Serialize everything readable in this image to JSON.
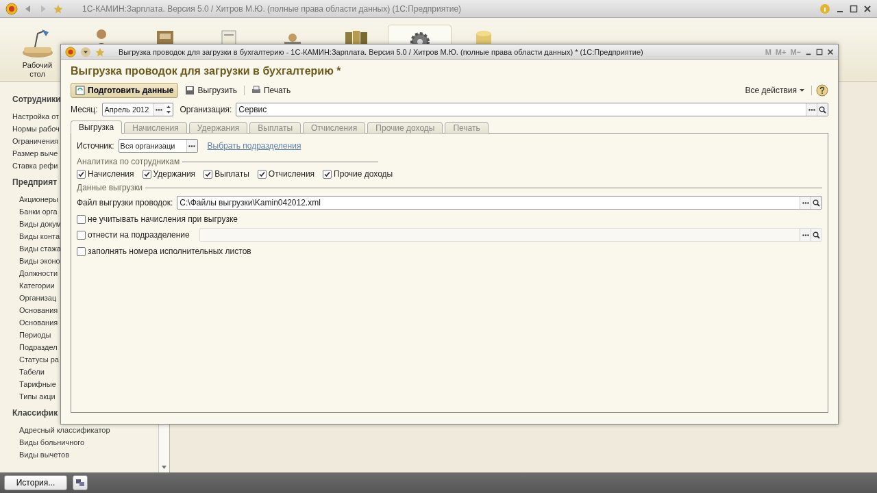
{
  "window": {
    "title": "1С-КАМИН:Зарплата. Версия 5.0 / Хитров М.Ю. (полные права области данных)  (1С:Предприятие)"
  },
  "section_bar": {
    "items": [
      {
        "kind": "desk",
        "label": "Рабочий стол",
        "selected": false
      },
      {
        "kind": "person",
        "selected": false
      },
      {
        "kind": "cabinet",
        "selected": false
      },
      {
        "kind": "document",
        "selected": false
      },
      {
        "kind": "people",
        "selected": false
      },
      {
        "kind": "books",
        "selected": false
      },
      {
        "kind": "gear",
        "selected": true
      },
      {
        "kind": "database",
        "selected": false
      }
    ]
  },
  "sidebar": {
    "groups": [
      {
        "title": "Сотрудники",
        "items": [
          "Настройка от",
          "Нормы рабоч",
          "Ограничения",
          "Размер выче",
          "Ставка рефи"
        ]
      },
      {
        "title": "Предприят",
        "items": [
          "Акционеры",
          "Банки орга",
          "Виды докум",
          "Виды конта",
          "Виды стажа",
          "Виды эконо",
          "Должности",
          "Категории",
          "Организац",
          "Основания",
          "Основания",
          "Периоды",
          "Подраздел",
          "Статусы ра",
          "Табели",
          "Тарифные",
          "Типы акци"
        ]
      },
      {
        "title": "Классифик",
        "items": [
          "Адресный классификатор",
          "Виды больничного",
          "Виды вычетов"
        ]
      }
    ]
  },
  "taskbar": {
    "history_button": "История..."
  },
  "dialog": {
    "title": "Выгрузка проводок для загрузки в бухгалтерию - 1С-КАМИН:Зарплата. Версия 5.0 / Хитров М.Ю. (полные права области данных) *  (1С:Предприятие)",
    "title_buttons": [
      "M",
      "M+",
      "M−"
    ],
    "heading": "Выгрузка проводок для загрузки в бухгалтерию *",
    "toolbar": {
      "prepare": "Подготовить данные",
      "export": "Выгрузить",
      "print": "Печать",
      "all_actions": "Все действия"
    },
    "month": {
      "label": "Месяц:",
      "value": "Апрель 2012"
    },
    "organization": {
      "label": "Организация:",
      "value": "Сервис"
    },
    "tabs": [
      {
        "label": "Выгрузка",
        "selected": true
      },
      {
        "label": "Начисления",
        "selected": false
      },
      {
        "label": "Удержания",
        "selected": false
      },
      {
        "label": "Выплаты",
        "selected": false
      },
      {
        "label": "Отчисления",
        "selected": false
      },
      {
        "label": "Прочие доходы",
        "selected": false
      },
      {
        "label": "Печать",
        "selected": false
      }
    ],
    "source": {
      "label": "Источник:",
      "value": "Вся организаци",
      "link": "Выбрать подразделения"
    },
    "analytics": {
      "title": "Аналитика по сотрудникам",
      "checkboxes": [
        {
          "label": "Начисления",
          "checked": true
        },
        {
          "label": "Удержания",
          "checked": true
        },
        {
          "label": "Выплаты",
          "checked": true
        },
        {
          "label": "Отчисления",
          "checked": true
        },
        {
          "label": "Прочие доходы",
          "checked": true
        }
      ]
    },
    "export_data": {
      "title": "Данные выгрузки",
      "file": {
        "label": "Файл выгрузки проводок:",
        "value": "C:\\Файлы выгрузки\\Kamin042012.xml"
      },
      "options": [
        {
          "kind": "plain",
          "label": "не учитывать начисления при выгрузке",
          "checked": false
        },
        {
          "kind": "with_field",
          "label": "отнести на подразделение",
          "checked": false
        },
        {
          "kind": "plain",
          "label": "заполнять номера исполнительных листов",
          "checked": false
        }
      ]
    }
  }
}
